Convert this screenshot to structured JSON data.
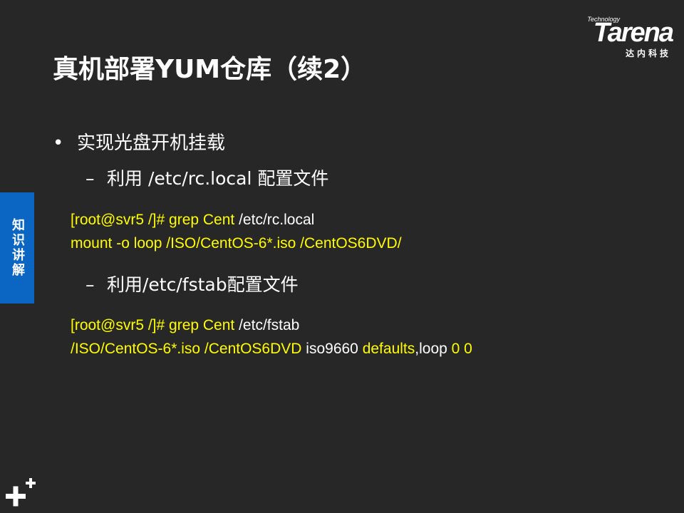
{
  "logo": {
    "technology": "Technology",
    "wordmark": "Tarena",
    "chinese": "达内科技"
  },
  "slide": {
    "title": "真机部署YUM仓库（续2）",
    "side_tab": "知识讲解",
    "bullet": {
      "symbol": "•",
      "text": "实现光盘开机挂载"
    },
    "sub1": {
      "dash": "–",
      "text": "利用 /etc/rc.local 配置文件"
    },
    "code1": {
      "line1_prompt": "[root@svr5 /]# grep  Cent",
      "line1_path": "  /etc/rc.local",
      "line2": "mount -o loop /ISO/CentOS-6*.iso /CentOS6DVD/"
    },
    "sub2": {
      "dash": "–",
      "text": "利用/etc/fstab配置文件"
    },
    "code2": {
      "line1_prompt": "[root@svr5 /]# grep  Cent",
      "line1_path": "  /etc/fstab",
      "line2_part1": "/ISO/CentOS-6*.iso  /CentOS6DVD",
      "line2_part2": "  iso9660 ",
      "line2_part3": "defaults",
      "line2_part4": ",loop ",
      "line2_part5": "0 0"
    }
  },
  "colors": {
    "background": "#272727",
    "code_highlight": "#ffff00",
    "side_tab": "#0a66c2"
  },
  "icons": {
    "corner": "plus-plus-icon"
  }
}
